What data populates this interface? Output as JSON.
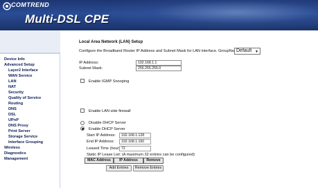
{
  "header": {
    "brand": "COMTREND",
    "product": "Multi-DSL CPE"
  },
  "sidebar": {
    "items": [
      {
        "label": "Device Info"
      },
      {
        "label": "Advanced Setup"
      },
      {
        "label": "Layer2 Interface"
      },
      {
        "label": "WAN Service"
      },
      {
        "label": "LAN"
      },
      {
        "label": "NAT"
      },
      {
        "label": "Security"
      },
      {
        "label": "Quality of Service"
      },
      {
        "label": "Routing"
      },
      {
        "label": "DNS"
      },
      {
        "label": "DSL"
      },
      {
        "label": "UPnP"
      },
      {
        "label": "DNS Proxy"
      },
      {
        "label": "Print Server"
      },
      {
        "label": "Storage Service"
      },
      {
        "label": "Interface Grouping"
      },
      {
        "label": "Wireless"
      },
      {
        "label": "Diagnostics"
      },
      {
        "label": "Management"
      }
    ]
  },
  "main": {
    "title": "Local Area Network (LAN) Setup",
    "description": "Configure the Broadband Router IP Address and Subnet Mask for LAN interface.  GroupName",
    "group_name": "Default",
    "ip_label": "IP Address:",
    "ip_value": "192.168.1.1",
    "subnet_label": "Subnet Mask:",
    "subnet_value": "255.255.255.0",
    "igmp_label": "Enable IGMP Snooping",
    "firewall_label": "Enable LAN side firewall",
    "disable_dhcp_label": "Disable DHCP Server",
    "enable_dhcp_label": "Enable DHCP Server",
    "start_ip_label": "Start IP Address:",
    "start_ip_value": "192.168.1.128",
    "end_ip_label": "End IP Address:",
    "end_ip_value": "192.168.1.160",
    "lease_label": "Leased Time (hour):",
    "lease_value": "72",
    "lease_list_label": "Static IP Lease List: (A maximum 32 entries can be configured)",
    "table_headers": [
      "MAC Address",
      "IP Address",
      "Remove"
    ],
    "add_entries": "Add Entries",
    "remove_entries": "Remove Entries"
  }
}
